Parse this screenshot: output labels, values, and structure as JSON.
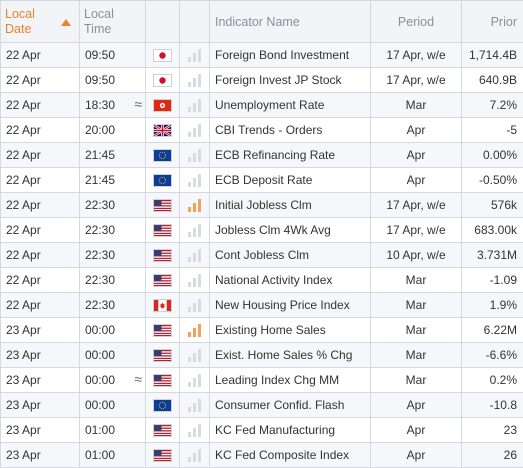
{
  "header": {
    "local_date_line1": "Local",
    "local_date_line2": "Date",
    "local_time_line1": "Local",
    "local_time_line2": "Time",
    "indicator": "Indicator Name",
    "period": "Period",
    "prior": "Prior"
  },
  "colors": {
    "sort_accent": "#e8842c",
    "impact_high": "#f0a35c",
    "impact_low": "#d8dbe0"
  },
  "rows": [
    {
      "date": "22 Apr",
      "time": "09:50",
      "approx": "",
      "flag": "jp",
      "impact": "low",
      "name": "Foreign Bond Investment",
      "period": "17 Apr, w/e",
      "prior": "1,714.4B"
    },
    {
      "date": "22 Apr",
      "time": "09:50",
      "approx": "",
      "flag": "jp",
      "impact": "low",
      "name": "Foreign Invest JP Stock",
      "period": "17 Apr, w/e",
      "prior": "640.9B"
    },
    {
      "date": "22 Apr",
      "time": "18:30",
      "approx": "≈",
      "flag": "hk",
      "impact": "low",
      "name": "Unemployment Rate",
      "period": "Mar",
      "prior": "7.2%"
    },
    {
      "date": "22 Apr",
      "time": "20:00",
      "approx": "",
      "flag": "gb",
      "impact": "low",
      "name": "CBI Trends - Orders",
      "period": "Apr",
      "prior": "-5"
    },
    {
      "date": "22 Apr",
      "time": "21:45",
      "approx": "",
      "flag": "eu",
      "impact": "low",
      "name": "ECB Refinancing Rate",
      "period": "Apr",
      "prior": "0.00%"
    },
    {
      "date": "22 Apr",
      "time": "21:45",
      "approx": "",
      "flag": "eu",
      "impact": "low",
      "name": "ECB Deposit Rate",
      "period": "Apr",
      "prior": "-0.50%"
    },
    {
      "date": "22 Apr",
      "time": "22:30",
      "approx": "",
      "flag": "us",
      "impact": "high",
      "name": "Initial Jobless Clm",
      "period": "17 Apr, w/e",
      "prior": "576k"
    },
    {
      "date": "22 Apr",
      "time": "22:30",
      "approx": "",
      "flag": "us",
      "impact": "low",
      "name": "Jobless Clm 4Wk Avg",
      "period": "17 Apr, w/e",
      "prior": "683.00k"
    },
    {
      "date": "22 Apr",
      "time": "22:30",
      "approx": "",
      "flag": "us",
      "impact": "low",
      "name": "Cont Jobless Clm",
      "period": "10 Apr, w/e",
      "prior": "3.731M"
    },
    {
      "date": "22 Apr",
      "time": "22:30",
      "approx": "",
      "flag": "us",
      "impact": "low",
      "name": "National Activity Index",
      "period": "Mar",
      "prior": "-1.09"
    },
    {
      "date": "22 Apr",
      "time": "22:30",
      "approx": "",
      "flag": "ca",
      "impact": "low",
      "name": "New Housing Price Index",
      "period": "Mar",
      "prior": "1.9%"
    },
    {
      "date": "23 Apr",
      "time": "00:00",
      "approx": "",
      "flag": "us",
      "impact": "high",
      "name": "Existing Home Sales",
      "period": "Mar",
      "prior": "6.22M"
    },
    {
      "date": "23 Apr",
      "time": "00:00",
      "approx": "",
      "flag": "us",
      "impact": "low",
      "name": "Exist. Home Sales % Chg",
      "period": "Mar",
      "prior": "-6.6%"
    },
    {
      "date": "23 Apr",
      "time": "00:00",
      "approx": "≈",
      "flag": "us",
      "impact": "low",
      "name": "Leading Index Chg MM",
      "period": "Mar",
      "prior": "0.2%"
    },
    {
      "date": "23 Apr",
      "time": "00:00",
      "approx": "",
      "flag": "eu",
      "impact": "low",
      "name": "Consumer Confid. Flash",
      "period": "Apr",
      "prior": "-10.8"
    },
    {
      "date": "23 Apr",
      "time": "01:00",
      "approx": "",
      "flag": "us",
      "impact": "low",
      "name": "KC Fed Manufacturing",
      "period": "Apr",
      "prior": "23"
    },
    {
      "date": "23 Apr",
      "time": "01:00",
      "approx": "",
      "flag": "us",
      "impact": "low",
      "name": "KC Fed Composite Index",
      "period": "Apr",
      "prior": "26"
    }
  ]
}
